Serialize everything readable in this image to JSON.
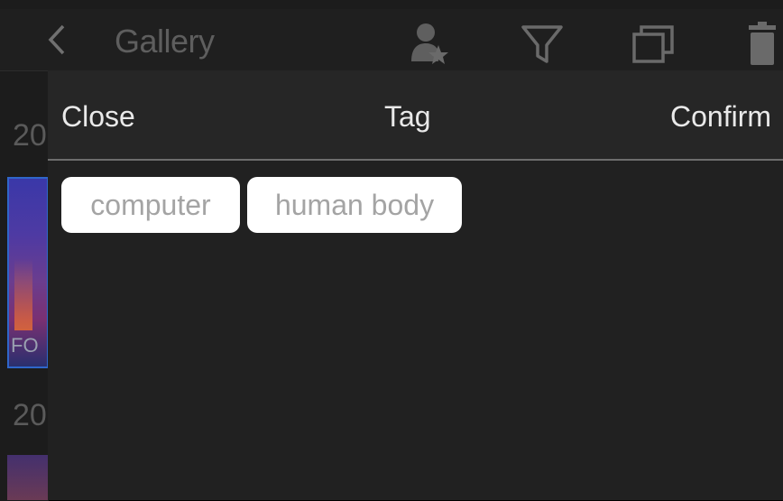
{
  "header": {
    "title": "Gallery",
    "icons": [
      "back-icon",
      "user-star-icon",
      "filter-icon",
      "copy-icon",
      "trash-icon"
    ]
  },
  "gallery": {
    "date_stub_1": "20",
    "date_stub_2": "20",
    "thumb_label": "FO"
  },
  "panel": {
    "close_label": "Close",
    "title": "Tag",
    "confirm_label": "Confirm",
    "tags": [
      "computer",
      "human body"
    ]
  },
  "colors": {
    "background": "#1c1c1c",
    "panel": "#212121",
    "panel_header": "#262626",
    "chip_bg": "#ffffff",
    "chip_text": "#a4a4a4",
    "header_text": "#e9e9e9"
  }
}
